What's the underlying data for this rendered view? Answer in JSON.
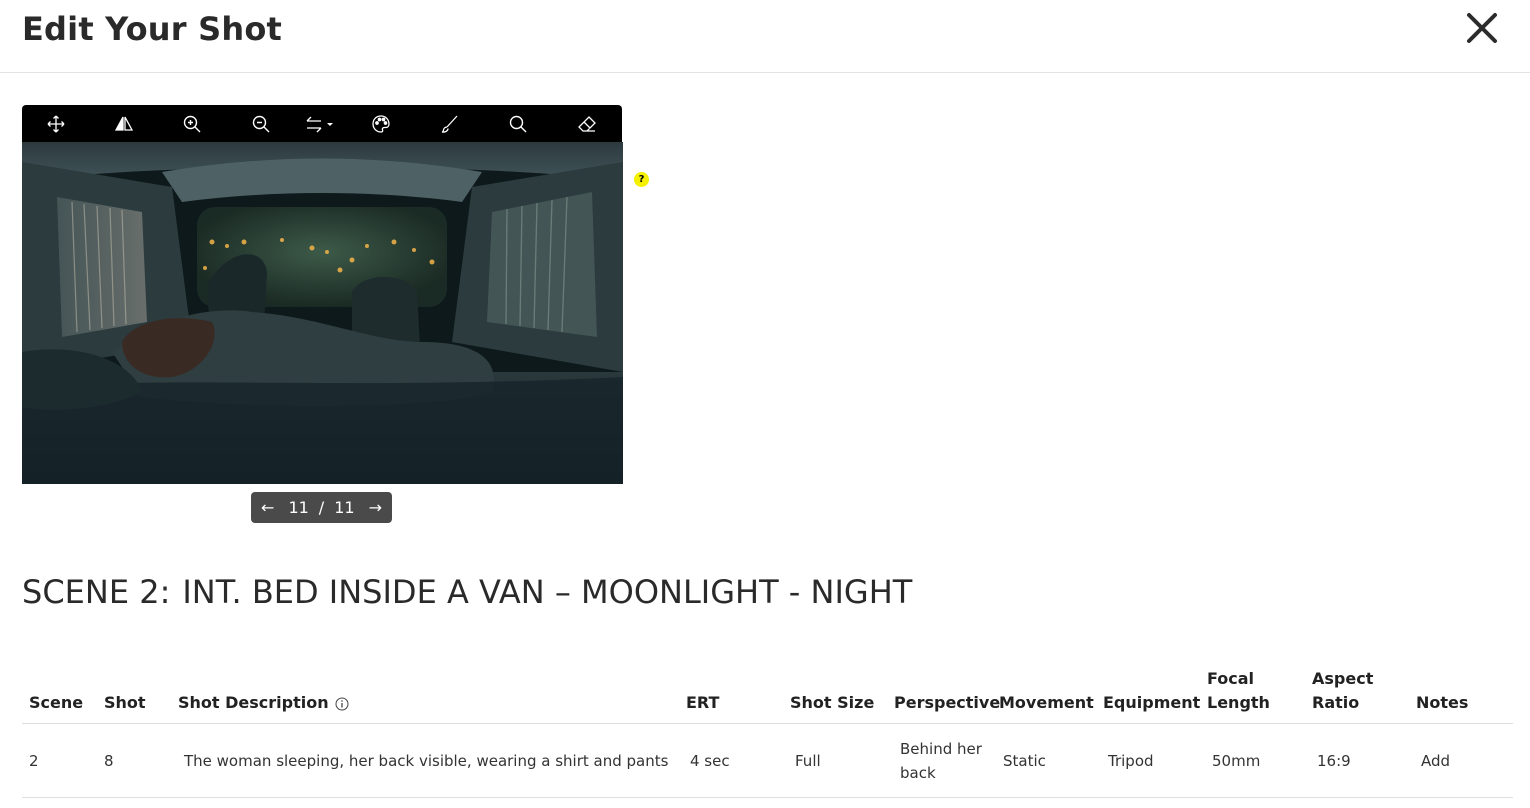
{
  "header": {
    "title": "Edit Your Shot"
  },
  "toolbar": {
    "tools": [
      "move-icon",
      "flip-icon",
      "zoom-in-icon",
      "zoom-out-icon",
      "swap-icon",
      "palette-icon",
      "brush-icon",
      "search-icon",
      "eraser-icon"
    ]
  },
  "help": {
    "label": "?"
  },
  "pager": {
    "prev": "←",
    "current": "11",
    "separator": "/",
    "total": "11",
    "next": "→"
  },
  "scene": {
    "label": "SCENE 2:",
    "heading": "INT. BED INSIDE A VAN – MOONLIGHT - NIGHT"
  },
  "table": {
    "headers": {
      "scene": "Scene",
      "shot": "Shot",
      "description": "Shot Description",
      "ert": "ERT",
      "shot_size": "Shot Size",
      "perspective": "Perspective",
      "movement": "Movement",
      "equipment": "Equipment",
      "focal_1": "Focal",
      "focal_2": "Length",
      "aspect_1": "Aspect",
      "aspect_2": "Ratio",
      "notes": "Notes"
    },
    "row": {
      "scene": "2",
      "shot": "8",
      "description": "The woman sleeping, her back visible, wearing a shirt and pants",
      "ert": "4 sec",
      "shot_size": "Full",
      "perspective_1": "Behind her",
      "perspective_2": "back",
      "movement": "Static",
      "equipment": "Tripod",
      "focal": "50mm",
      "aspect": "16:9",
      "notes": "Add"
    }
  }
}
